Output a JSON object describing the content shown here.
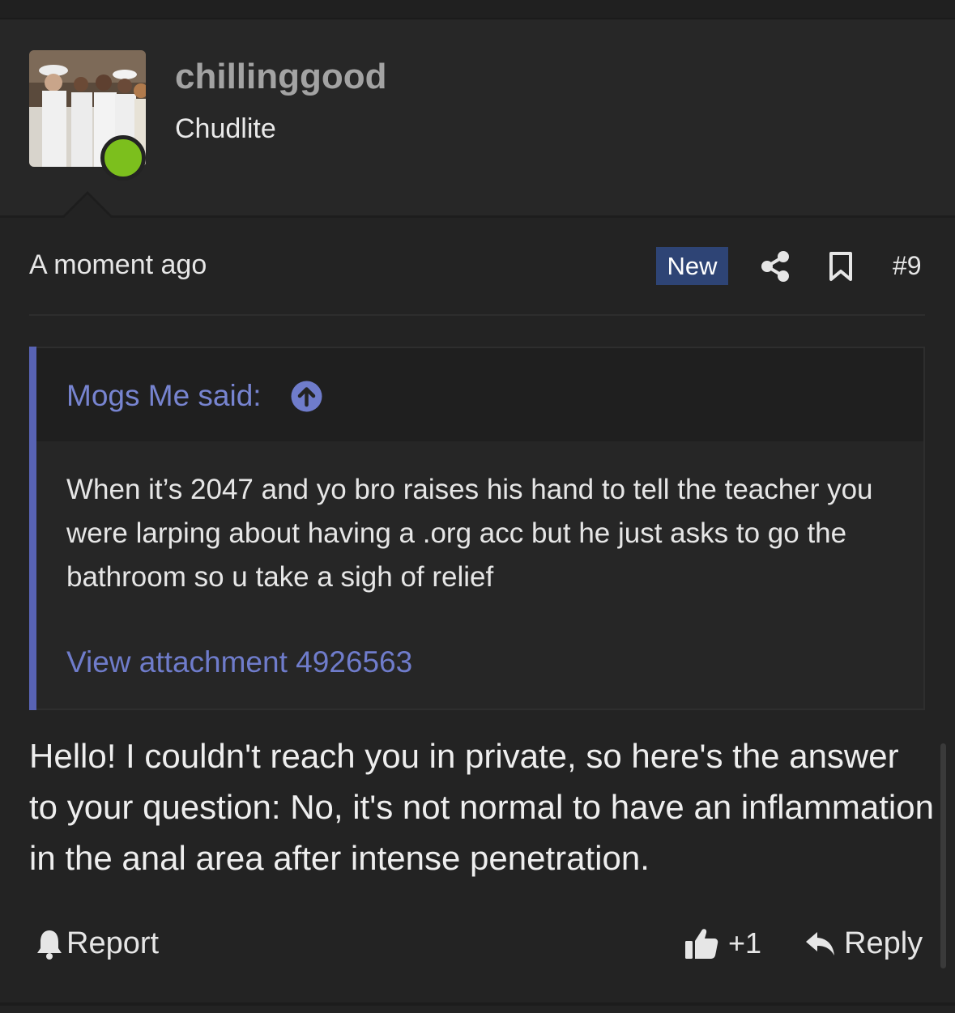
{
  "user": {
    "username": "chillinggood",
    "user_title": "Chudlite",
    "status_color": "#7cbf1d"
  },
  "post": {
    "timestamp": "A moment ago",
    "badge": "New",
    "number": "#9",
    "quote": {
      "author_label": "Mogs Me said:",
      "text": "When it’s 2047 and yo bro raises his hand to tell the teacher you were larping about having a .org acc but he just asks to go the bathroom so u take a sigh of relief",
      "attachment_link": "View attachment 4926563"
    },
    "body": "Hello! I couldn't reach you in private, so here's the answer to your question: No, it's not normal to have an inflammation in the anal area after intense penetration.",
    "actions": {
      "report_label": "Report",
      "like_count": "+1",
      "reply_label": "Reply"
    }
  },
  "icons": {
    "share": "share-icon",
    "bookmark": "bookmark-icon",
    "quote_up": "arrow-up-circle-icon",
    "report": "bell-icon",
    "like": "thumbs-up-icon",
    "reply": "reply-arrow-icon"
  },
  "colors": {
    "background": "#232323",
    "accent": "#5863b4",
    "link": "#7784d0",
    "new_badge": "#2e4475"
  }
}
